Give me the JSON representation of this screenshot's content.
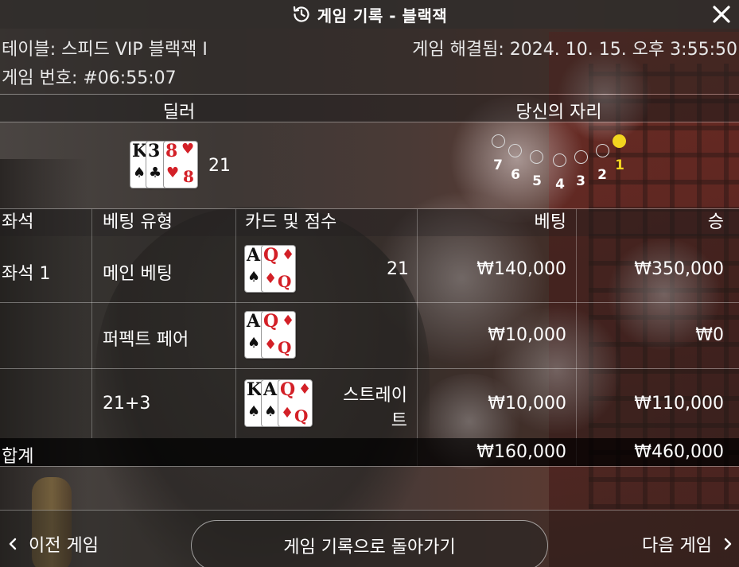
{
  "window": {
    "title": "게임 기록 - 블랙잭",
    "history_icon": "history-clock-icon",
    "close_icon": "close-icon"
  },
  "info": {
    "table": "테이블: 스피드 VIP 블랙잭 I",
    "resolved": "게임 해결됨: 2024. 10. 15. 오후 3:55:50",
    "game_number": "게임 번호: #06:55:07"
  },
  "sections": {
    "dealer": "딜러",
    "your_seat": "당신의 자리"
  },
  "dealer": {
    "score": "21",
    "cards": [
      {
        "rank": "K",
        "suit": "♠",
        "color": "black"
      },
      {
        "rank": "3",
        "suit": "♣",
        "color": "black"
      },
      {
        "rank": "8",
        "suit": "♥",
        "color": "red"
      }
    ]
  },
  "seats": {
    "labels": [
      "7",
      "6",
      "5",
      "4",
      "3",
      "2",
      "1"
    ],
    "active": "1",
    "active_color": "#f2d51f"
  },
  "table": {
    "headers": {
      "seat": "좌석",
      "bet_type": "베팅 유형",
      "cards_score": "카드 및 점수",
      "bet": "베팅",
      "win": "승"
    },
    "rows": [
      {
        "seat": "좌석 1",
        "bet_type": "메인 베팅",
        "cards": [
          {
            "rank": "A",
            "suit": "♠",
            "color": "black"
          },
          {
            "rank": "Q",
            "suit": "♦",
            "color": "red"
          }
        ],
        "result": "21",
        "bet": "₩140,000",
        "win": "₩350,000"
      },
      {
        "seat": "",
        "bet_type": "퍼펙트 페어",
        "cards": [
          {
            "rank": "A",
            "suit": "♠",
            "color": "black"
          },
          {
            "rank": "Q",
            "suit": "♦",
            "color": "red"
          }
        ],
        "result": "",
        "bet": "₩10,000",
        "win": "₩0"
      },
      {
        "seat": "",
        "bet_type": "21+3",
        "cards": [
          {
            "rank": "K",
            "suit": "♠",
            "color": "black"
          },
          {
            "rank": "A",
            "suit": "♠",
            "color": "black"
          },
          {
            "rank": "Q",
            "suit": "♦",
            "color": "red"
          }
        ],
        "result_line1": "스트레이",
        "result_line2": "트",
        "bet": "₩10,000",
        "win": "₩110,000"
      }
    ],
    "total": {
      "label": "합계",
      "bet": "₩160,000",
      "win": "₩460,000"
    }
  },
  "footer": {
    "prev_label": "이전 게임",
    "back_label": "게임 기록으로 돌아가기",
    "next_label": "다음 게임",
    "prev_icon": "chevron-left-icon",
    "next_icon": "chevron-right-icon"
  }
}
